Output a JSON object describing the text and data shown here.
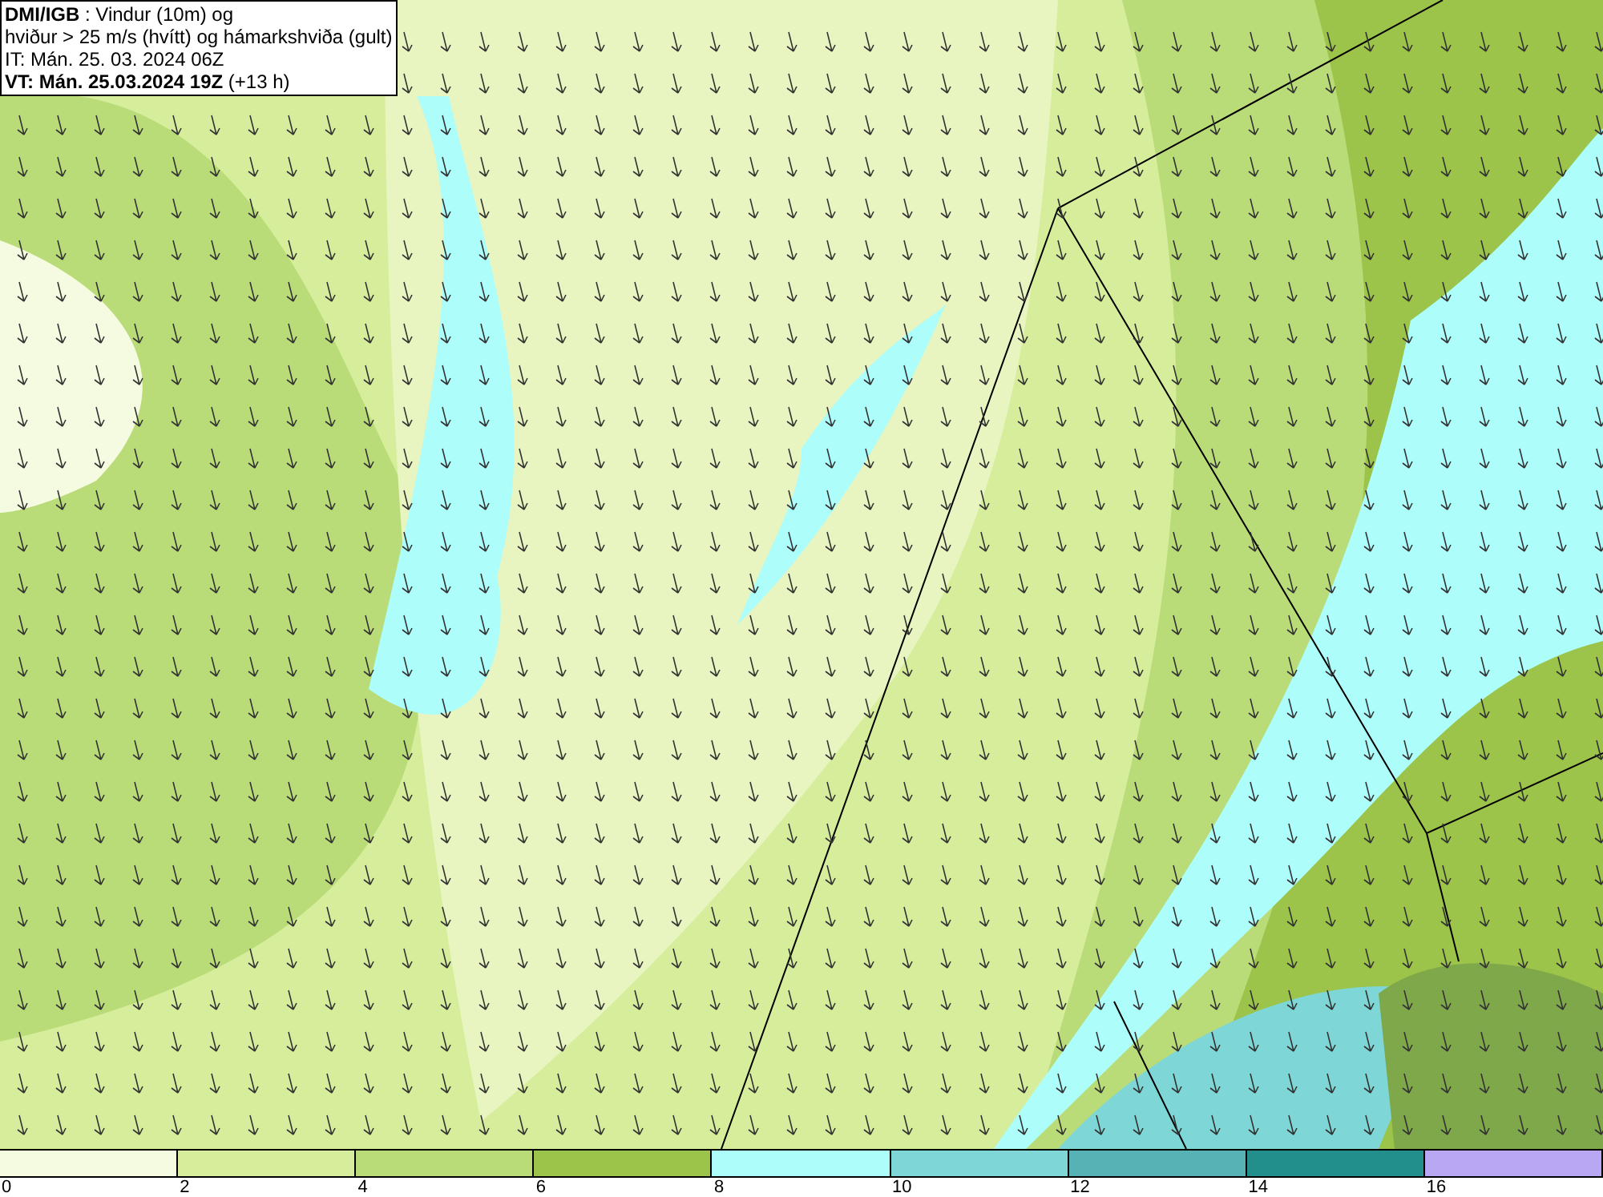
{
  "header": {
    "lines": [
      "**DMI/IGB** : Vindur (10m) og",
      "hviður > 25 m/s (hvítt) og hámarkshviða (gult)",
      "IT: Mán. 25. 03. 2024 06Z",
      "**VT: Mán. 25.03.2024 19Z** (+13 h)"
    ]
  },
  "legend": {
    "segments": [
      {
        "color": "#f5fbe0"
      },
      {
        "color": "#d6ee9c"
      },
      {
        "color": "#b9dc78"
      },
      {
        "color": "#9cc34a"
      },
      {
        "color": "#adfdfb"
      },
      {
        "color": "#7fd6d6"
      },
      {
        "color": "#56b2b4"
      },
      {
        "color": "#228f8c"
      },
      {
        "color": "#b9a7f3"
      }
    ],
    "labels": [
      "0",
      "2",
      "4",
      "6",
      "8",
      "10",
      "12",
      "14",
      "16"
    ]
  }
}
